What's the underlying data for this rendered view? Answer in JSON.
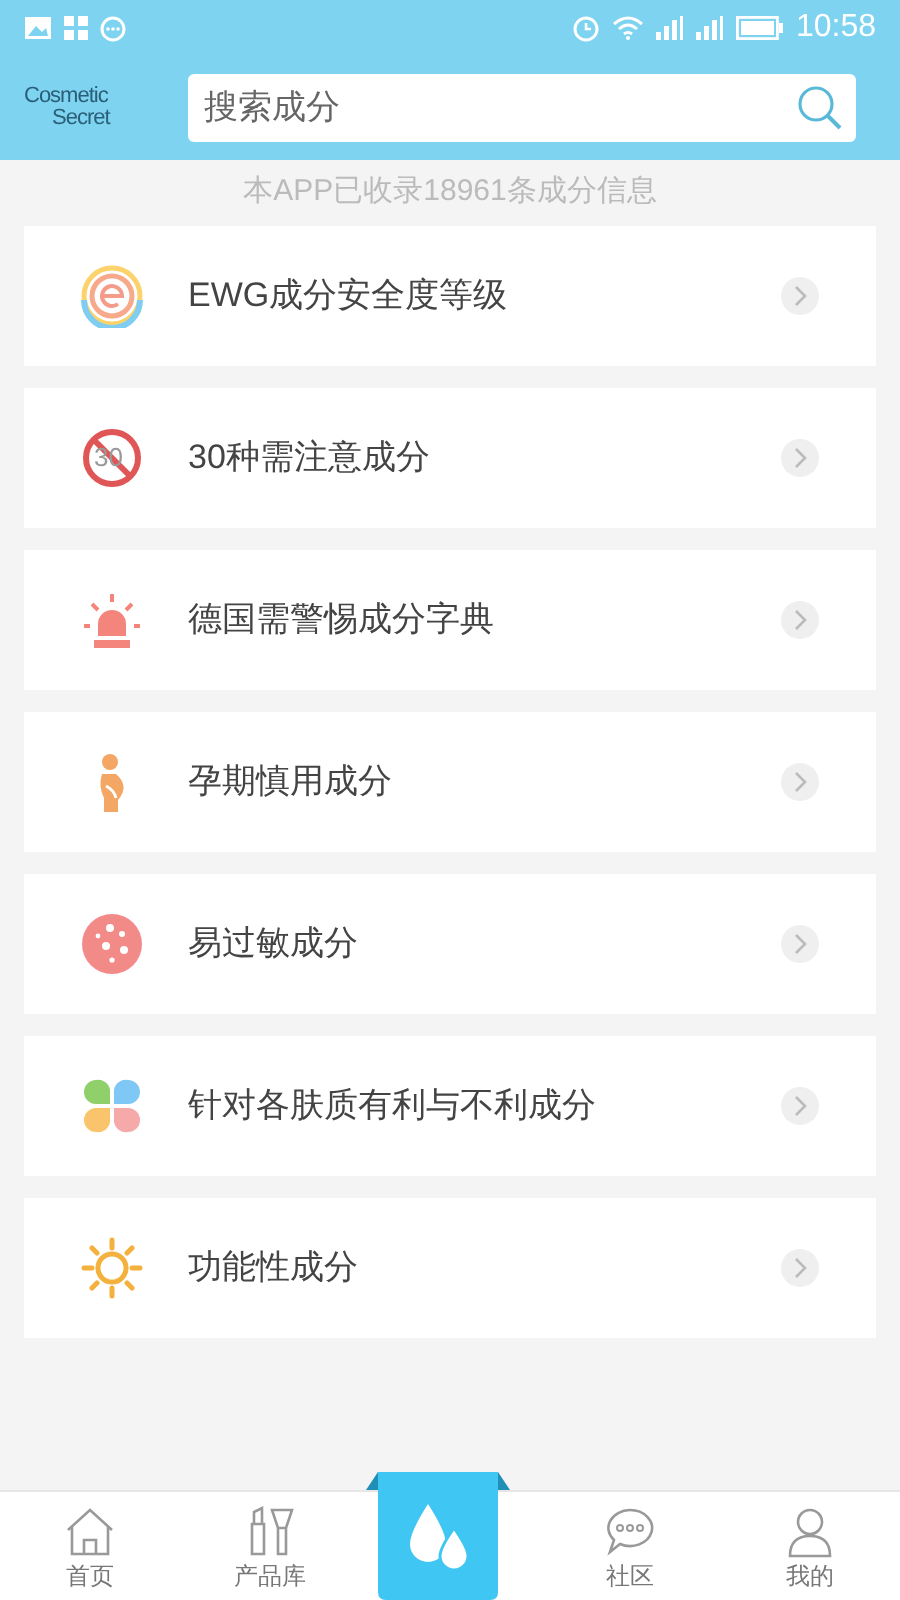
{
  "status_bar": {
    "time": "10:58"
  },
  "header": {
    "logo": [
      "Cosmetic",
      "Secret"
    ],
    "search": {
      "placeholder": "搜索成分"
    }
  },
  "info": "本APP已收录18961条成分信息",
  "menu": [
    {
      "kind": "ewg",
      "label": "EWG成分安全度等级"
    },
    {
      "kind": "no30",
      "label": "30种需注意成分",
      "icon_text": "30"
    },
    {
      "kind": "siren",
      "label": "德国需警惕成分字典"
    },
    {
      "kind": "pregnant",
      "label": "孕期慎用成分"
    },
    {
      "kind": "allergy",
      "label": "易过敏成分"
    },
    {
      "kind": "clover",
      "label": "针对各肤质有利与不利成分"
    },
    {
      "kind": "sun",
      "label": "功能性成分"
    }
  ],
  "tabs": [
    {
      "kind": "home",
      "label": "首页",
      "selected": false
    },
    {
      "kind": "products",
      "label": "产品库",
      "selected": false
    },
    {
      "kind": "center",
      "selected": true
    },
    {
      "kind": "community",
      "label": "社区",
      "selected": false
    },
    {
      "kind": "me",
      "label": "我的",
      "selected": false
    }
  ]
}
